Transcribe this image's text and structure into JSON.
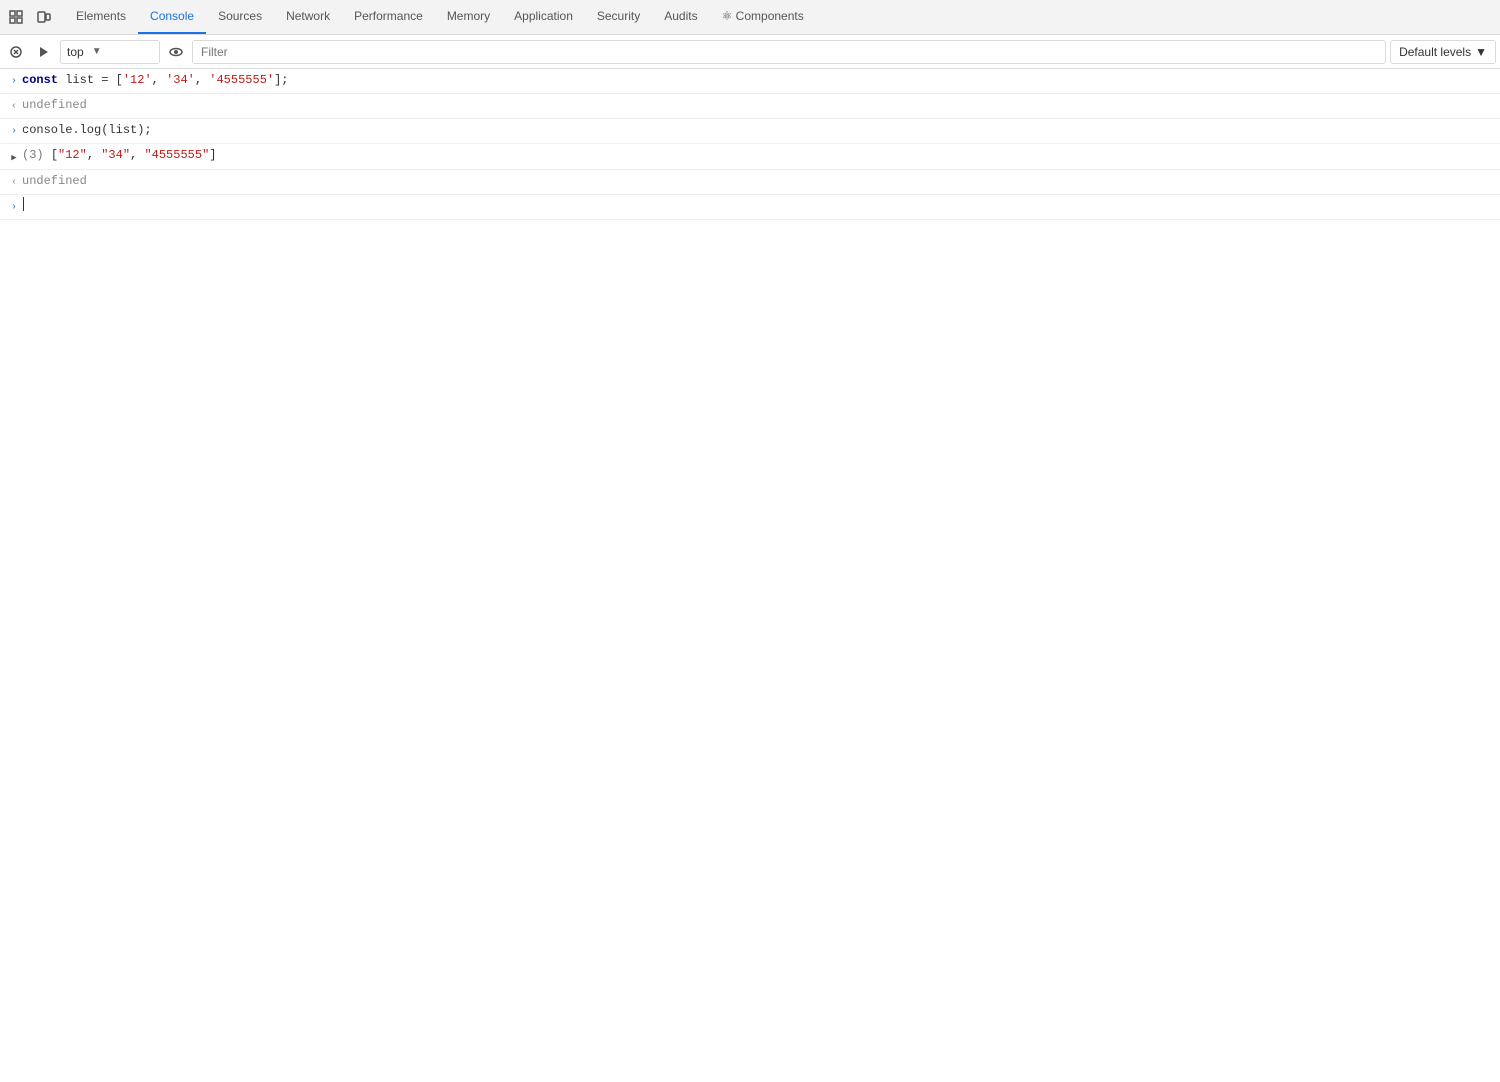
{
  "nav": {
    "tabs": [
      {
        "id": "elements",
        "label": "Elements",
        "active": false
      },
      {
        "id": "console",
        "label": "Console",
        "active": true
      },
      {
        "id": "sources",
        "label": "Sources",
        "active": false
      },
      {
        "id": "network",
        "label": "Network",
        "active": false
      },
      {
        "id": "performance",
        "label": "Performance",
        "active": false
      },
      {
        "id": "memory",
        "label": "Memory",
        "active": false
      },
      {
        "id": "application",
        "label": "Application",
        "active": false
      },
      {
        "id": "security",
        "label": "Security",
        "active": false
      },
      {
        "id": "audits",
        "label": "Audits",
        "active": false
      },
      {
        "id": "components",
        "label": "⚛ Components",
        "active": false
      }
    ]
  },
  "toolbar": {
    "context_value": "top",
    "context_placeholder": "top",
    "filter_placeholder": "Filter",
    "levels_label": "Default levels",
    "levels_arrow": "▼"
  },
  "console": {
    "entries": [
      {
        "id": "entry1",
        "type": "input",
        "arrow": ">",
        "code_html": "<span class='kw'>const</span> <span class='var-name'>list</span> <span class='op'>=</span> <span class='punc'>[</span><span class='str'>'12'</span><span class='punc'>,</span> <span class='str'>'34'</span><span class='punc'>,</span> <span class='str'>'4555555'</span><span class='punc'>];</span>"
      },
      {
        "id": "entry2",
        "type": "output",
        "arrow": "<",
        "text": "undefined"
      },
      {
        "id": "entry3",
        "type": "input",
        "arrow": ">",
        "code_html": "<span class='fn-name'>console.log</span><span class='punc'>(list);</span>"
      },
      {
        "id": "entry4",
        "type": "array-output",
        "arrow": "▶",
        "code_html": "<span class='array-count'>(3)</span> <span class='punc'>[</span><span class='array-str'>\"12\"</span><span class='punc'>,</span> <span class='array-str'> \"34\"</span><span class='punc'>,</span> <span class='array-str'> \"4555555\"</span><span class='punc'>]</span>"
      },
      {
        "id": "entry5",
        "type": "output",
        "arrow": "<",
        "text": "undefined"
      },
      {
        "id": "entry6",
        "type": "input-cursor",
        "arrow": ">"
      }
    ]
  }
}
